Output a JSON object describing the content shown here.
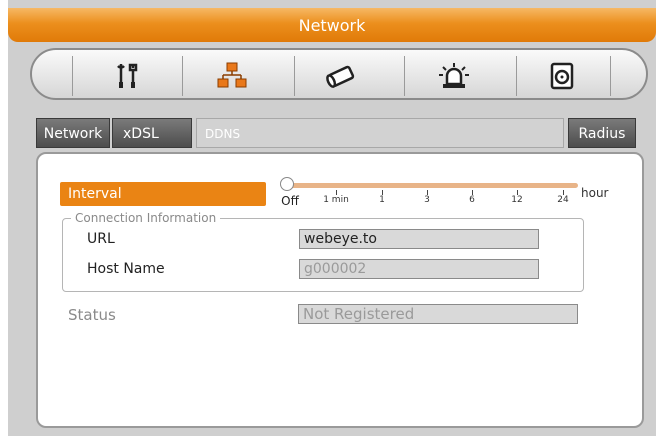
{
  "window": {
    "title": "Network"
  },
  "toolbar": {
    "items": [
      {
        "icon": "tools-icon",
        "label": ""
      },
      {
        "icon": "network-icon",
        "label": ""
      },
      {
        "icon": "camera-icon",
        "label": ""
      },
      {
        "icon": "alarm-icon",
        "label": ""
      },
      {
        "icon": "disk-icon",
        "label": ""
      }
    ]
  },
  "tabs": [
    {
      "label": "Network"
    },
    {
      "label": "xDSL"
    },
    {
      "label": "DDNS"
    },
    {
      "label": "Radius"
    }
  ],
  "interval": {
    "label": "Interval",
    "ticks": [
      "Off",
      "1 min",
      "1",
      "3",
      "6",
      "12",
      "24"
    ],
    "unit": "hour",
    "value": "Off"
  },
  "connection": {
    "legend": "Connection Information",
    "url_label": "URL",
    "url_value": "webeye.to",
    "host_label": "Host Name",
    "host_value": "g000002"
  },
  "status": {
    "label": "Status",
    "value": "Not Registered"
  },
  "colors": {
    "accent": "#ea8414",
    "tab_dark": "#5a5a5a",
    "panel_bg": "#cfcfcf"
  }
}
